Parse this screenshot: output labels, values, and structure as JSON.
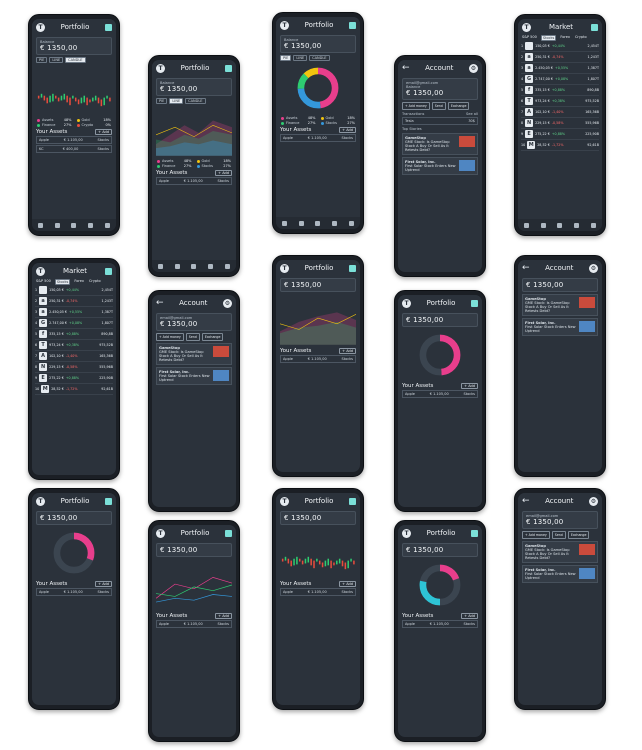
{
  "portfolio": {
    "title": "Portfolio",
    "balance_label": "Balance",
    "balance": "€ 1350,00",
    "tabs": [
      "PIE",
      "LINE",
      "CANDLE"
    ],
    "legend": [
      {
        "name": "Assets",
        "pct": "48%",
        "color": "#e83e8c"
      },
      {
        "name": "Gold",
        "pct": "18%",
        "color": "#f1c40f"
      },
      {
        "name": "Finance",
        "pct": "27%",
        "color": "#2ecc71"
      },
      {
        "name": "Crypto",
        "pct": "0%",
        "color": "#e74c3c"
      },
      {
        "name": "Stocks",
        "pct": "27%",
        "color": "#3498db"
      },
      {
        "name": "Other",
        "pct": "0%",
        "color": "#95a5a6"
      }
    ],
    "risk": "Investment Risk: 75/10",
    "assets_title": "Your Assets",
    "add": "+ Add",
    "rows": [
      {
        "name": "Apple",
        "value": "€ 1.105,00",
        "tag": "Stocks"
      },
      {
        "name": "KC",
        "value": "€ 400,00",
        "tag": "Stocks"
      },
      {
        "name": "Cardano",
        "value": "€ 100,00",
        "tag": "Crypto"
      }
    ]
  },
  "market": {
    "title": "Market",
    "tabs": [
      "S&P 500",
      "Stocks",
      "Forex",
      "Crypto",
      "NFT"
    ],
    "cols": [
      "#",
      "Name",
      "Price",
      "1%",
      "Market value"
    ],
    "rows": [
      {
        "n": "1",
        "logo": "",
        "price": "150,03 €",
        "chg": "+0,44%",
        "cap": "2,454T",
        "up": true
      },
      {
        "n": "2",
        "logo": "a",
        "price": "250,31 €",
        "chg": "-0,74%",
        "cap": "1,243T",
        "up": false
      },
      {
        "n": "3",
        "logo": "a",
        "price": "2.450,05 €",
        "chg": "+0,55%",
        "cap": "1,387T",
        "up": true
      },
      {
        "n": "4",
        "logo": "G",
        "price": "2.747,00 €",
        "chg": "+0,08%",
        "cap": "1,807T",
        "up": true
      },
      {
        "n": "5",
        "logo": "f",
        "price": "335,15 €",
        "chg": "+0,88%",
        "cap": "890,8B",
        "up": true
      },
      {
        "n": "6",
        "logo": "T",
        "price": "973,24 €",
        "chg": "+0,38%",
        "cap": "975,52B",
        "up": true
      },
      {
        "n": "7",
        "logo": "A",
        "price": "102,10 €",
        "chg": "-1,40%",
        "cap": "165,36B",
        "up": false
      },
      {
        "n": "8",
        "logo": "N",
        "price": "229,15 €",
        "chg": "-0,58%",
        "cap": "555,96B",
        "up": false
      },
      {
        "n": "9",
        "logo": "E",
        "price": "275,22 €",
        "chg": "+0,88%",
        "cap": "225,90B",
        "up": true
      },
      {
        "n": "10",
        "logo": "M",
        "price": "28,52 €",
        "chg": "-1,72%",
        "cap": "92,61B",
        "up": false
      }
    ]
  },
  "account": {
    "title": "Account",
    "verified": "Verified",
    "email": "email@gmail.com",
    "balance_label": "Balance",
    "balance": "€ 1350,00",
    "buttons": [
      "+ Add money",
      "Send",
      "Exchange"
    ],
    "transactions": "Transactions",
    "see_all": "See all",
    "txn_name": "Tesla",
    "txn_val": "30$",
    "news_title": "Top Stories",
    "news": [
      {
        "head": "GameStop",
        "body": "GME Stock: Is GameStop Stock A Buy Or Sell As It Retests Debt?",
        "meta": "5 minutes ago · Investor's Daily"
      },
      {
        "head": "First Solar, Inc.",
        "body": "First Solar Stock Enters New Uptrend",
        "meta": "15 minutes ago · Investopedia"
      }
    ]
  },
  "colors": {
    "bg": "#2b323b",
    "pink": "#e83e8c",
    "green": "#2ecc71",
    "blue": "#3498db",
    "yellow": "#f1c40f",
    "red": "#e74c3c"
  }
}
